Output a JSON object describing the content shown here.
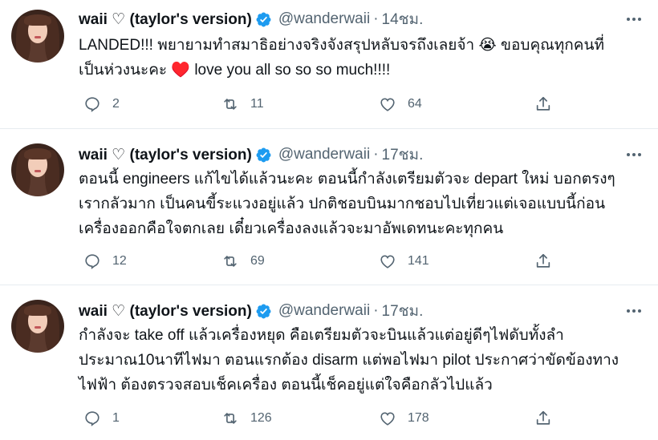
{
  "tweets": [
    {
      "name": "waii ♡ (taylor's version)",
      "handle": "@wanderwaii",
      "separator": "·",
      "time": "14ชม.",
      "lines": [
        "LANDED!!! พยายามทำสมาธิอย่างจริงจังสรุปหลับจรถึงเลยจ้า 😭 ขอบคุณทุกคนที่",
        "เป็นห่วงนะคะ ♥️ love you all so so so much!!!!"
      ],
      "replies": "2",
      "retweets": "11",
      "likes": "64"
    },
    {
      "name": "waii ♡ (taylor's version)",
      "handle": "@wanderwaii",
      "separator": "·",
      "time": "17ชม.",
      "lines": [
        "ตอนนี้ engineers แก้ไขได้แล้วนะคะ ตอนนี้กำลังเตรียมตัวจะ depart ใหม่ บอกตรงๆ",
        "เรากลัวมาก เป็นคนขี้ระแวงอยู่แล้ว ปกติชอบบินมากชอบไปเที่ยวแต่เจอแบบนี้ก่อน",
        "เครื่องออกคือใจตกเลย เดี๋ยวเครื่องลงแล้วจะมาอัพเดทนะคะทุกคน"
      ],
      "replies": "12",
      "retweets": "69",
      "likes": "141"
    },
    {
      "name": "waii ♡ (taylor's version)",
      "handle": "@wanderwaii",
      "separator": "·",
      "time": "17ชม.",
      "lines": [
        "กำลังจะ take off แล้วเครื่องหยุด คือเตรียมตัวจะบินแล้วแต่อยู่ดีๆไฟดับทั้งลำ",
        "ประมาณ10นาทีไฟมา ตอนแรกต้อง disarm แต่พอไฟมา pilot ประกาศว่าขัดข้องทาง",
        "ไฟฟ้า ต้องตรวจสอบเช็คเครื่อง ตอนนี้เช็คอยู่แต่ใจคือกลัวไปแล้ว"
      ],
      "replies": "1",
      "retweets": "126",
      "likes": "178"
    }
  ],
  "icons": {
    "verified": "verified-badge-icon",
    "reply": "reply-icon",
    "retweet": "retweet-icon",
    "like": "heart-icon",
    "share": "share-icon",
    "more": "more-options-icon"
  },
  "colors": {
    "verified": "#1d9bf0",
    "text": "#0f1419",
    "secondary": "#536471",
    "divider": "#e6ecf0"
  }
}
